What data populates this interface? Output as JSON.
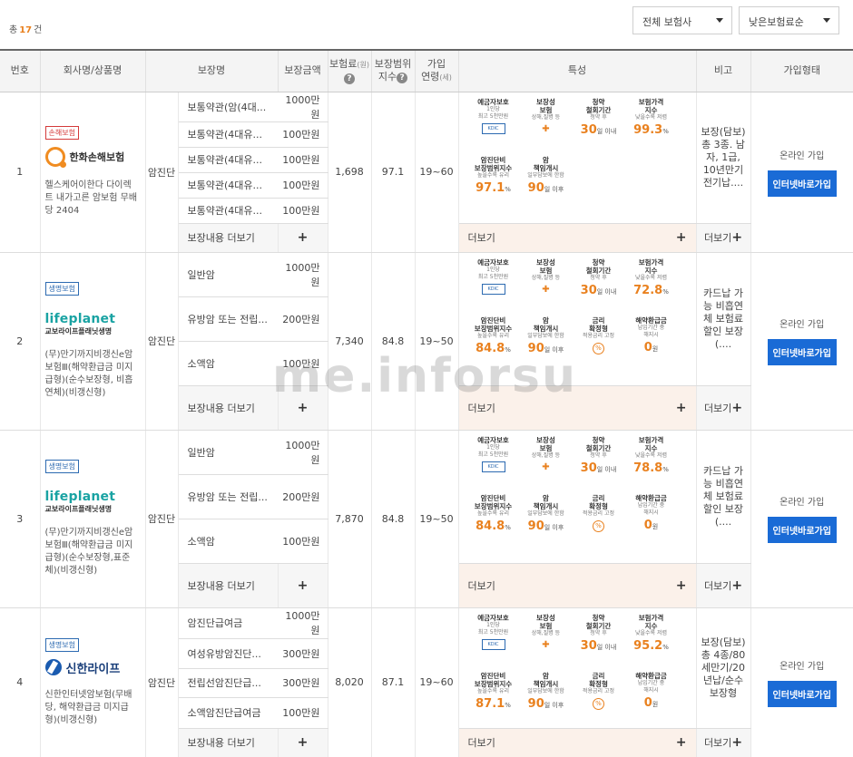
{
  "summary": {
    "prefix": "총",
    "count": "17",
    "suffix": "건"
  },
  "filters": {
    "company": "전체 보험사",
    "sort": "낮은보험료순"
  },
  "columns": {
    "no": "번호",
    "company": "회사명/상품명",
    "coverage": "보장명",
    "amount": "보장금액",
    "premium": "보험료",
    "premium_unit": "(원)",
    "scope": "보장범위",
    "scope2": "지수",
    "age": "가입",
    "age2": "연령",
    "age_unit": "(세)",
    "features": "특성",
    "note": "비고",
    "join": "가입형태"
  },
  "common": {
    "more": "보장내용 더보기",
    "feat_more": "더보기",
    "note_more": "더보기",
    "online": "온라인 가입",
    "join_btn": "인터넷바로가입",
    "watermark": "me.inforsu"
  },
  "features_labels": {
    "f1": [
      "예금자보호",
      "1인당",
      "최고 5천만원"
    ],
    "f2": [
      "보장성",
      "보험",
      "상해,질병 등"
    ],
    "f3": [
      "청약",
      "철회기간",
      "청약 후"
    ],
    "f4": [
      "보험가격",
      "지수",
      "낮을수록 저렴"
    ],
    "f5": [
      "암진단비",
      "보장범위지수",
      "높을수록 유리"
    ],
    "f6": [
      "암",
      "책임개시",
      "일부담보에 한함"
    ],
    "f7": [
      "금리",
      "확정형",
      "적용금리 고정"
    ],
    "f8": [
      "해약환급금",
      "납입기간 중",
      "해지시"
    ],
    "unit_days": "일 이내",
    "unit_after": "일 이후",
    "unit_pct": "%",
    "unit_won": "원"
  },
  "rows": [
    {
      "no": "1",
      "badge": "손해보험",
      "logo": "한화손해보험",
      "product": "헬스케어이한다 다이렉트 내가고른 암보험 무배당 2404",
      "category": "암진단",
      "coverages": [
        {
          "name": "보통약관(암(4대...",
          "amount": "1000만원"
        },
        {
          "name": "보통약관(4대유...",
          "amount": "100만원"
        },
        {
          "name": "보통약관(4대유...",
          "amount": "100만원"
        },
        {
          "name": "보통약관(4대유...",
          "amount": "100만원"
        },
        {
          "name": "보통약관(4대유...",
          "amount": "100만원"
        }
      ],
      "premium": "1,698",
      "scope": "97.1",
      "age": "19~60",
      "withdraw": "30",
      "price_idx": "99.3",
      "cover_idx": "97.1",
      "resp": "90",
      "note": "보장(담보) 총 3종. 남자, 1급, 10년만기 전기납...."
    },
    {
      "no": "2",
      "badge": "생명보험",
      "logo1": "lifeplanet",
      "logo2": "교보라이프플래닛생명",
      "product": "(무)만기까지비갱신e암보험Ⅲ(해약환급금 미지급형)(순수보장형, 비흡연체)(비갱신형)",
      "category": "암진단",
      "coverages": [
        {
          "name": "일반암",
          "amount": "1000만원"
        },
        {
          "name": "유방암 또는 전립...",
          "amount": "200만원"
        },
        {
          "name": "소액암",
          "amount": "100만원"
        }
      ],
      "premium": "7,340",
      "scope": "84.8",
      "age": "19~50",
      "withdraw": "30",
      "price_idx": "72.8",
      "cover_idx": "84.8",
      "resp": "90",
      "refund": "0",
      "note": "카드납 가능 비흡연체 보험료 할인 보장(...."
    },
    {
      "no": "3",
      "badge": "생명보험",
      "logo1": "lifeplanet",
      "logo2": "교보라이프플래닛생명",
      "product": "(무)만기까지비갱신e암보험Ⅲ(해약환급금 미지급형)(순수보장형,표준체)(비갱신형)",
      "category": "암진단",
      "coverages": [
        {
          "name": "일반암",
          "amount": "1000만원"
        },
        {
          "name": "유방암 또는 전립...",
          "amount": "200만원"
        },
        {
          "name": "소액암",
          "amount": "100만원"
        }
      ],
      "premium": "7,870",
      "scope": "84.8",
      "age": "19~50",
      "withdraw": "30",
      "price_idx": "78.8",
      "cover_idx": "84.8",
      "resp": "90",
      "refund": "0",
      "note": "카드납 가능 비흡연체 보험료 할인 보장(...."
    },
    {
      "no": "4",
      "badge": "생명보험",
      "logo": "신한라이프",
      "product": "신한인터넷암보험(무배당, 해약환급금 미지급형)(비갱신형)",
      "category": "암진단",
      "coverages": [
        {
          "name": "암진단급여금",
          "amount": "1000만원"
        },
        {
          "name": "여성유방암진단...",
          "amount": "300만원"
        },
        {
          "name": "전립선암진단급...",
          "amount": "300만원"
        },
        {
          "name": "소액암진단급여금",
          "amount": "100만원"
        }
      ],
      "premium": "8,020",
      "scope": "87.1",
      "age": "19~60",
      "withdraw": "30",
      "price_idx": "95.2",
      "cover_idx": "87.1",
      "resp": "90",
      "refund": "0",
      "note": "보장(담보) 총 4종/80세만기/20년납/순수보장형"
    }
  ]
}
